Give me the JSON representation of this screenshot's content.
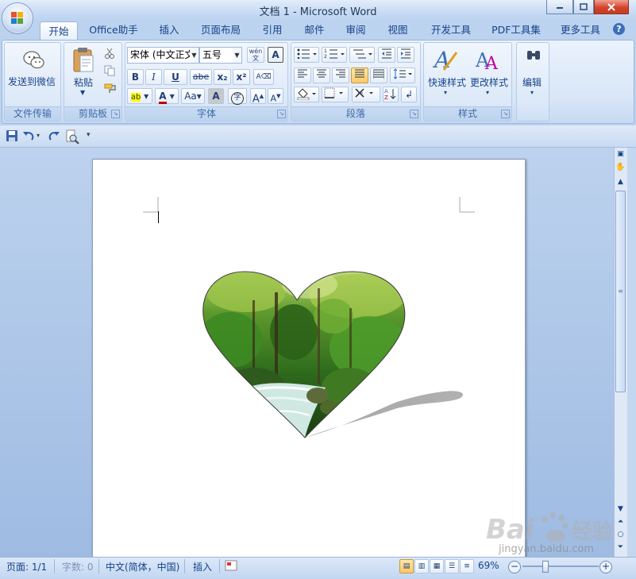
{
  "window": {
    "title": "文档 1 - Microsoft Word"
  },
  "tabs": [
    {
      "label": "开始",
      "active": true
    },
    {
      "label": "Office助手"
    },
    {
      "label": "插入"
    },
    {
      "label": "页面布局"
    },
    {
      "label": "引用"
    },
    {
      "label": "邮件"
    },
    {
      "label": "审阅"
    },
    {
      "label": "视图"
    },
    {
      "label": "开发工具"
    },
    {
      "label": "PDF工具集"
    },
    {
      "label": "更多工具"
    }
  ],
  "ribbon": {
    "wechat": {
      "button_label": "发送到微信",
      "group_label": "文件传输"
    },
    "clipboard": {
      "paste_label": "粘贴",
      "group_label": "剪贴板"
    },
    "font": {
      "font_name": "宋体 (中文正文",
      "font_size": "五号",
      "group_label": "字体",
      "bold": "B",
      "italic": "I",
      "underline": "U",
      "strike": "abe",
      "subscript": "x₂",
      "superscript": "x²",
      "grow": "A",
      "shrink": "A",
      "change_case": "Aa",
      "char_shading": "A",
      "enclose": "字",
      "phonetic": "wén"
    },
    "paragraph": {
      "group_label": "段落"
    },
    "styles": {
      "quick_styles_label": "快速样式",
      "change_styles_label": "更改样式",
      "group_label": "样式"
    },
    "editing": {
      "label": "编辑"
    }
  },
  "status": {
    "page": "页面: 1/1",
    "words": "字数: 0",
    "language": "中文(简体，中国)",
    "insert_mode": "插入",
    "zoom": "69%"
  },
  "watermark": {
    "text": "jingyan.baidu.com"
  },
  "colors": {
    "ribbon_blue": "#15428b",
    "highlight_yellow": "#ffff00",
    "font_color_red": "#c00000",
    "active_button": "#ffc868"
  },
  "document": {
    "shape": "heart",
    "shape_fill": "forest stream photo",
    "shape_effect": "perspective shadow"
  }
}
